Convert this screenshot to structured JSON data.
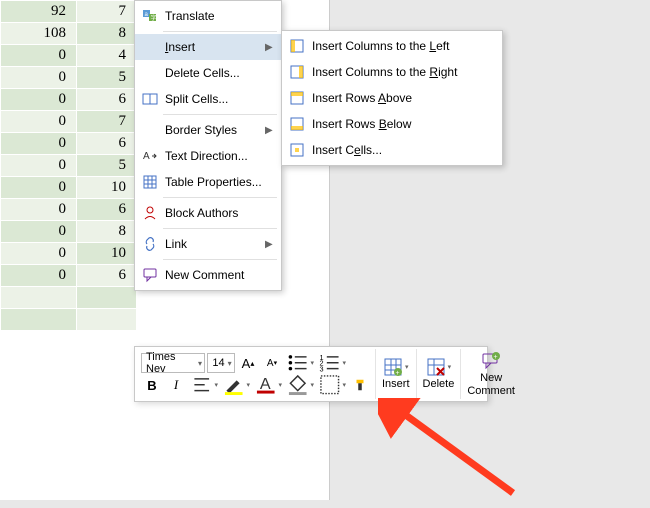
{
  "table": {
    "rows": [
      [
        "92",
        "7"
      ],
      [
        "108",
        "8"
      ],
      [
        "0",
        "4"
      ],
      [
        "0",
        "5"
      ],
      [
        "0",
        "6"
      ],
      [
        "0",
        "7"
      ],
      [
        "0",
        "6"
      ],
      [
        "0",
        "5"
      ],
      [
        "0",
        "10"
      ],
      [
        "0",
        "6"
      ],
      [
        "0",
        "8"
      ],
      [
        "0",
        "10"
      ],
      [
        "0",
        "6"
      ]
    ],
    "empty_rows": 2
  },
  "context_menu": {
    "translate": "Translate",
    "insert": "Insert",
    "delete_cells": "Delete Cells...",
    "split_cells": "Split Cells...",
    "border_styles": "Border Styles",
    "text_direction": "Text Direction...",
    "table_properties": "Table Properties...",
    "block_authors": "Block Authors",
    "link": "Link",
    "new_comment": "New Comment"
  },
  "submenu": {
    "cols_left": "Insert Columns to the Left",
    "cols_right": "Insert Columns to the Right",
    "rows_above": "Insert Rows Above",
    "rows_below": "Insert Rows Below",
    "cells": "Insert Cells..."
  },
  "underline": {
    "s": "S",
    "e": "e",
    "I": "I",
    "A": "A",
    "B": "B",
    "L": "L",
    "R": "R"
  },
  "mini_toolbar": {
    "font_name": "Times Nev",
    "font_size": "14",
    "increase_a": "A",
    "decrease_a": "A",
    "bold": "B",
    "italic": "I",
    "insert_label": "Insert",
    "delete_label": "Delete",
    "new_comment_label": "New\nComment"
  },
  "colors": {
    "highlight": "#d8e4f0",
    "arrow": "#ff3b1f"
  }
}
